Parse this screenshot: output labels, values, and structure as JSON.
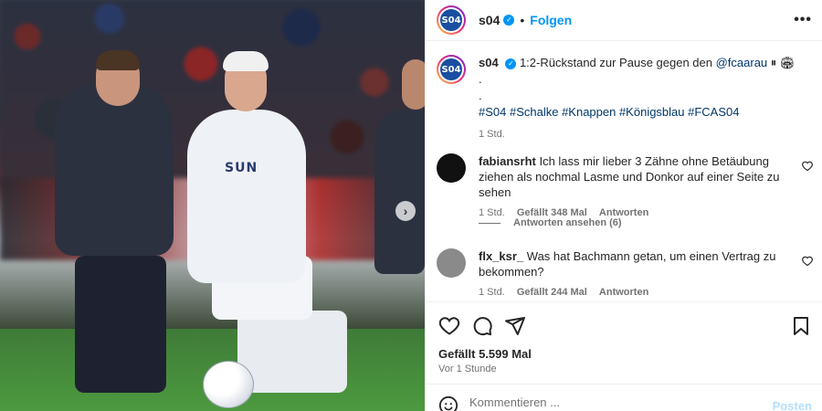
{
  "photo": {
    "sponsor_text": "SUN",
    "next_label": "›"
  },
  "header": {
    "username": "s04",
    "follow_label": "Folgen",
    "logo_text": "S04",
    "more_label": "•••"
  },
  "caption": {
    "username": "s04",
    "text": "1:2-Rückstand zur Pause gegen den",
    "mention": "@fcaarau",
    "emoji": "⏸ 🏟",
    "dot1": ".",
    "dot2": ".",
    "hashtags": "#S04 #Schalke #Knappen #Königsblau #FCAS04",
    "time": "1 Std."
  },
  "comments": [
    {
      "username": "fabiansrht",
      "text": "Ich lass mir lieber 3 Zähne ohne Betäubung ziehen als nochmal Lasme und Donkor auf einer Seite zu sehen",
      "time": "1 Std.",
      "likes": "Gefällt 348 Mal",
      "reply_label": "Antworten",
      "view_replies": "Antworten ansehen (6)"
    },
    {
      "username": "flx_ksr_",
      "text": "Was hat Bachmann getan, um einen Vertrag zu bekommen?",
      "time": "1 Std.",
      "likes": "Gefällt 244 Mal",
      "reply_label": "Antworten"
    }
  ],
  "post": {
    "likes": "Gefällt 5.599 Mal",
    "posted": "Vor 1 Stunde"
  },
  "comment_box": {
    "placeholder": "Kommentieren ...",
    "post_label": "Posten"
  },
  "colors": {
    "accent": "#0095f6",
    "text": "#262626",
    "muted": "#737373",
    "link": "#00376b"
  }
}
